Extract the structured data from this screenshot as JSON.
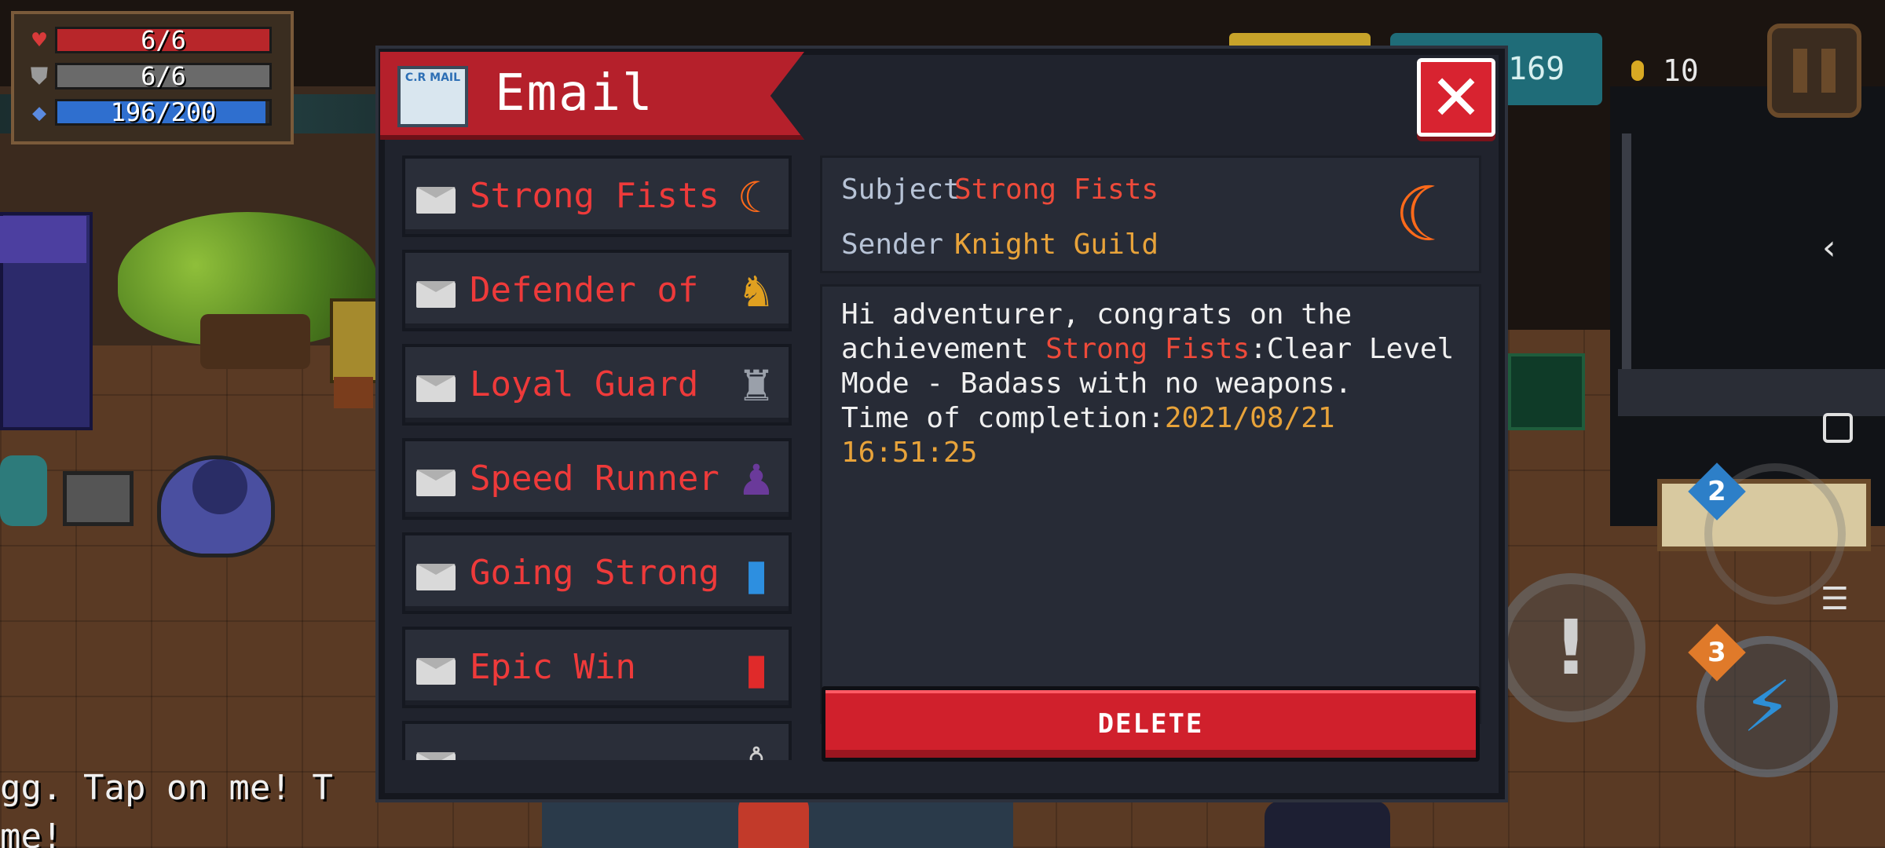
{
  "hud": {
    "hp": "6/6",
    "armor": "6/6",
    "energy": "196/200",
    "gems": "169",
    "coins": "10"
  },
  "dialog": {
    "title": "Email",
    "mail_icon_text": "C.R MAIL",
    "close_label": "✕",
    "delete_label": "DELETE"
  },
  "mails": [
    {
      "name": "Strong Fists",
      "icon": "crescent-fist-icon"
    },
    {
      "name": "Defender of S",
      "icon": "golden-knight-icon"
    },
    {
      "name": "Loyal Guard",
      "icon": "armored-guard-icon"
    },
    {
      "name": "Speed Runner",
      "icon": "purple-runner-icon"
    },
    {
      "name": "Going Strong",
      "icon": "blue-card-icon"
    },
    {
      "name": "Epic Win",
      "icon": "red-card-icon"
    },
    {
      "name": "",
      "icon": "partial-item-icon"
    }
  ],
  "detail": {
    "subject_label": "Subject",
    "subject_value": "Strong Fists",
    "sender_label": "Sender",
    "sender_value": "Knight Guild",
    "body_line1": "Hi adventurer, congrats on the",
    "body_line2_prefix": "achievement ",
    "body_line2_highlight": "Strong Fists",
    "body_line2_suffix": ":Clear Level",
    "body_line3": "Mode - Badass with no weapons.",
    "body_line4_prefix": "Time of completion:",
    "body_line4_value": "2021/08/21 16:51:25"
  },
  "scene": {
    "chat_line1": "gg. Tap on me! T",
    "chat_line2": "me!"
  },
  "badges": {
    "weapon_slot": "2",
    "skill_charges": "3"
  },
  "colors": {
    "accent_red": "#d0202c",
    "highlight_red": "#ee4a3a",
    "highlight_orange": "#e8a33a",
    "panel": "#20232d"
  }
}
